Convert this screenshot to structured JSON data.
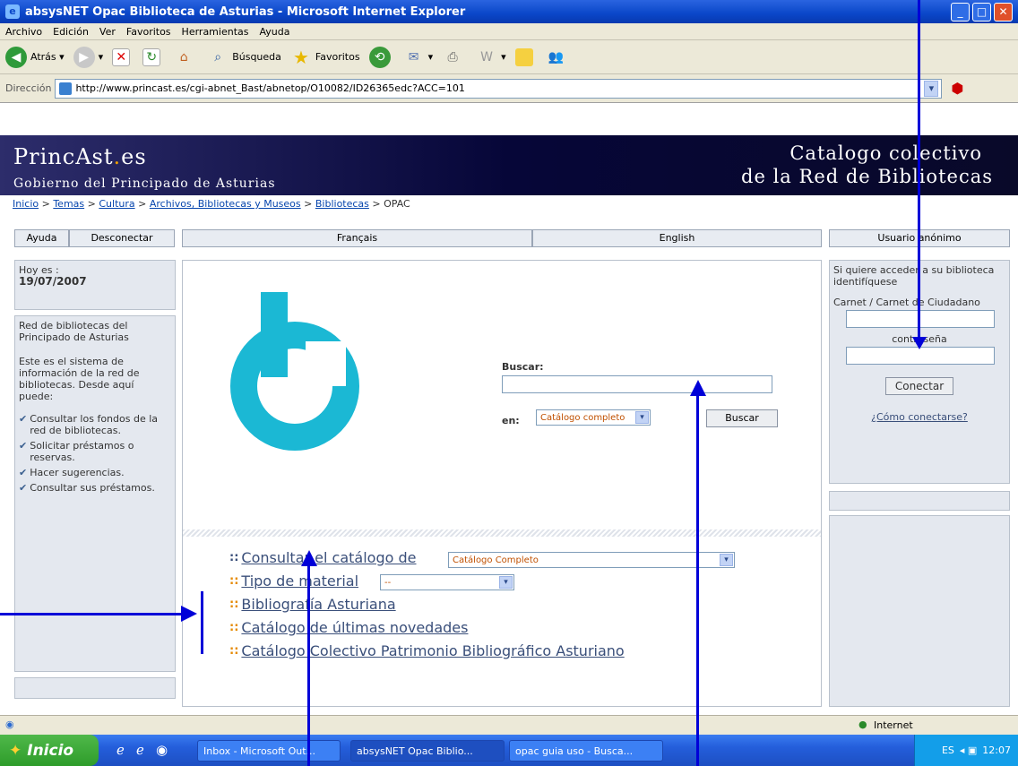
{
  "window": {
    "title": "absysNET Opac Biblioteca de Asturias - Microsoft Internet Explorer"
  },
  "menu": [
    "Archivo",
    "Edición",
    "Ver",
    "Favoritos",
    "Herramientas",
    "Ayuda"
  ],
  "toolbar": {
    "back": "Atrás",
    "search": "Búsqueda",
    "favorites": "Favoritos"
  },
  "address": {
    "label": "Dirección",
    "url": "http://www.princast.es/cgi-abnet_Bast/abnetop/O10082/ID26365edc?ACC=101"
  },
  "banner": {
    "brand_pre": "PrincAst",
    "brand_dot": ".",
    "brand_post": "es",
    "gov": "Gobierno del Principado de Asturias",
    "catalog_line1": "Catalogo colectivo",
    "catalog_line2": "de la Red de Bibliotecas"
  },
  "breadcrumb": {
    "items": [
      "Inicio",
      "Temas",
      "Cultura",
      "Archivos, Bibliotecas y Museos",
      "Bibliotecas"
    ],
    "current": "OPAC"
  },
  "nav": {
    "help": "Ayuda",
    "disconnect": "Desconectar",
    "french": "Français",
    "english": "English",
    "user": "Usuario anónimo"
  },
  "left": {
    "today_label": "Hoy es :",
    "date": "19/07/2007",
    "network": "Red de bibliotecas del Principado de Asturias",
    "intro": "Este es el sistema de información de la red de bibliotecas. Desde aquí puede:",
    "bullets": [
      "Consultar los fondos de la red de bibliotecas.",
      "Solicitar préstamos o reservas.",
      "Hacer sugerencias.",
      "Consultar sus préstamos."
    ]
  },
  "search": {
    "label": "Buscar:",
    "in_label": "en:",
    "scope": "Catálogo completo",
    "button": "Buscar"
  },
  "links": {
    "consult": "Consultar el catálogo de",
    "consult_select": "Catálogo Completo",
    "material": "Tipo de material",
    "material_select": "--",
    "bibliography": "Bibliografía Asturiana",
    "news": "Catálogo de últimas novedades",
    "heritage": "Catálogo Colectivo Patrimonio Bibliográfico Asturiano"
  },
  "login": {
    "intro": "Si quiere acceder a su biblioteca identifíquese",
    "card_label": "Carnet / Carnet de Ciudadano",
    "password_label": "contraseña",
    "connect": "Conectar",
    "howto": "¿Cómo conectarse?"
  },
  "status": {
    "zone": "Internet"
  },
  "taskbar": {
    "start": "Inicio",
    "tasks": [
      "Inbox - Microsoft Out...",
      "absysNET Opac Biblio...",
      "opac guia uso - Busca..."
    ],
    "lang": "ES",
    "time": "12:07"
  },
  "colors": {
    "arrow": "#0000d8",
    "logo": "#1bb8d4",
    "banner": "#0a0a40"
  }
}
